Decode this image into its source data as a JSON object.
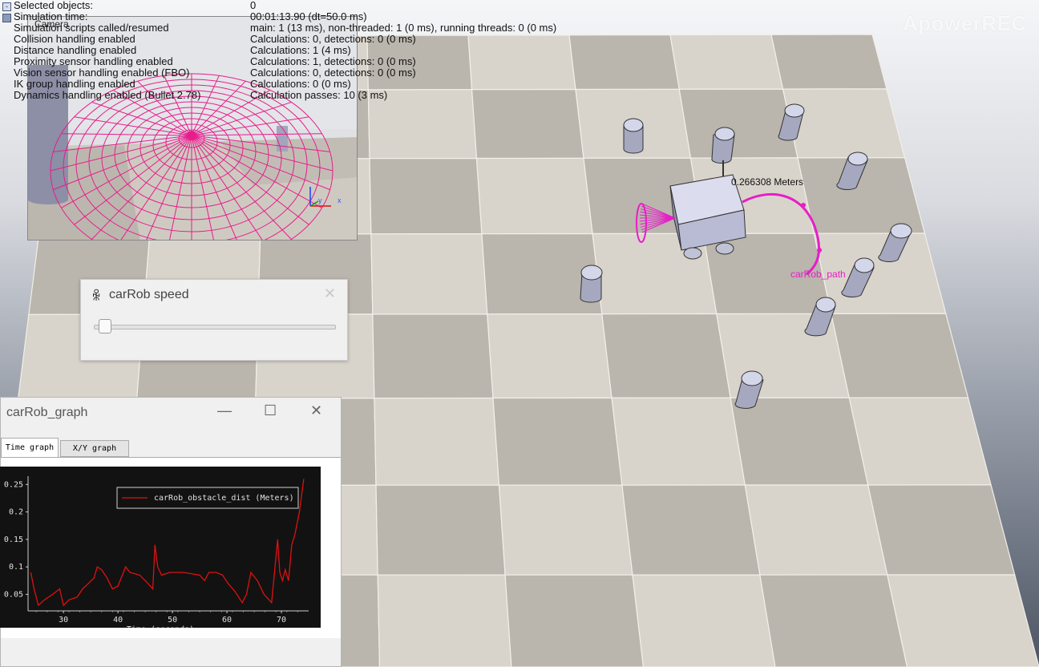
{
  "info": {
    "rows": [
      {
        "key": "Selected objects:",
        "value": "0"
      },
      {
        "key": "Simulation time:",
        "value": "00:01:13.90 (dt=50.0 ms)"
      },
      {
        "key": "Simulation scripts called/resumed",
        "value": "main: 1 (13 ms), non-threaded: 1 (0 ms), running threads: 0 (0 ms)"
      },
      {
        "key": "Collision handling enabled",
        "value": "Calculations: 0, detections: 0 (0 ms)"
      },
      {
        "key": "Distance handling enabled",
        "value": "Calculations: 1 (4 ms)"
      },
      {
        "key": "Proximity sensor handling enabled",
        "value": "Calculations: 1, detections: 0 (0 ms)"
      },
      {
        "key": "Vision sensor handling enabled (FBO)",
        "value": "Calculations: 0, detections: 0 (0 ms)"
      },
      {
        "key": "IK group handling enabled",
        "value": "Calculations: 0 (0 ms)"
      },
      {
        "key": "Dynamics handling enabled (Bullet 2.78)",
        "value": "Calculation passes: 10 (3 ms)"
      }
    ],
    "collapse_glyph": "-"
  },
  "watermark": "ApowerREC",
  "camera": {
    "title": "Camera",
    "axis_labels": {
      "x": "x",
      "y": "y"
    }
  },
  "scene": {
    "distance_label": "0.266308 Meters",
    "path_label": "carRob_path",
    "floor_light": "#d9d4cb",
    "floor_dark": "#bab5ad",
    "accent_magenta": "#e61ec8",
    "cylinder_color": "#c6c8dc"
  },
  "speed_dialog": {
    "title": "carRob speed",
    "icon": "robot-icon",
    "close": "✕",
    "slider_value": 0.02
  },
  "graph_window": {
    "title": "carRob_graph",
    "min": "—",
    "max": "☐",
    "close": "✕",
    "tabs": [
      "Time graph",
      "X/Y graph"
    ],
    "active_tab": "Time graph"
  },
  "chart_data": {
    "type": "line",
    "xlabel": "Time (seconds)",
    "ylabel": "",
    "xlim": [
      23.5,
      75
    ],
    "ylim": [
      0.02,
      0.265
    ],
    "x_ticks": [
      30,
      40,
      50,
      60,
      70
    ],
    "y_ticks": [
      0.05,
      0.1,
      0.15,
      0.2,
      0.25
    ],
    "x_tick_labels": [
      "30",
      "40",
      "50",
      "60",
      "70"
    ],
    "y_tick_labels": [
      "0.05",
      "0.1",
      "0.15",
      "0.2",
      "0.25"
    ],
    "legend_position": "top-right",
    "series": [
      {
        "name": "carRob_obstacle_dist (Meters)",
        "color": "#e01010",
        "x": [
          24,
          24.6,
          25.4,
          26.5,
          28,
          29.3,
          30,
          31,
          32.5,
          33.5,
          34.6,
          35.6,
          36.2,
          37,
          38,
          39,
          40,
          41.4,
          42.2,
          44,
          45.5,
          46.4,
          46.8,
          47.3,
          48,
          49.5,
          52,
          55,
          55.9,
          56.7,
          58,
          59.2,
          60.2,
          61.5,
          62.8,
          63.6,
          64.4,
          65.6,
          66.8,
          68.2,
          69.3,
          69.7,
          70.2,
          70.7,
          71.3,
          71.9,
          72.5,
          73.3,
          74.1
        ],
        "y": [
          0.09,
          0.06,
          0.03,
          0.04,
          0.05,
          0.06,
          0.03,
          0.04,
          0.045,
          0.06,
          0.07,
          0.08,
          0.1,
          0.095,
          0.08,
          0.06,
          0.065,
          0.1,
          0.09,
          0.085,
          0.07,
          0.06,
          0.14,
          0.1,
          0.085,
          0.09,
          0.09,
          0.085,
          0.075,
          0.09,
          0.09,
          0.085,
          0.07,
          0.055,
          0.035,
          0.05,
          0.09,
          0.075,
          0.05,
          0.035,
          0.15,
          0.09,
          0.075,
          0.095,
          0.075,
          0.14,
          0.16,
          0.2,
          0.26
        ]
      }
    ]
  }
}
